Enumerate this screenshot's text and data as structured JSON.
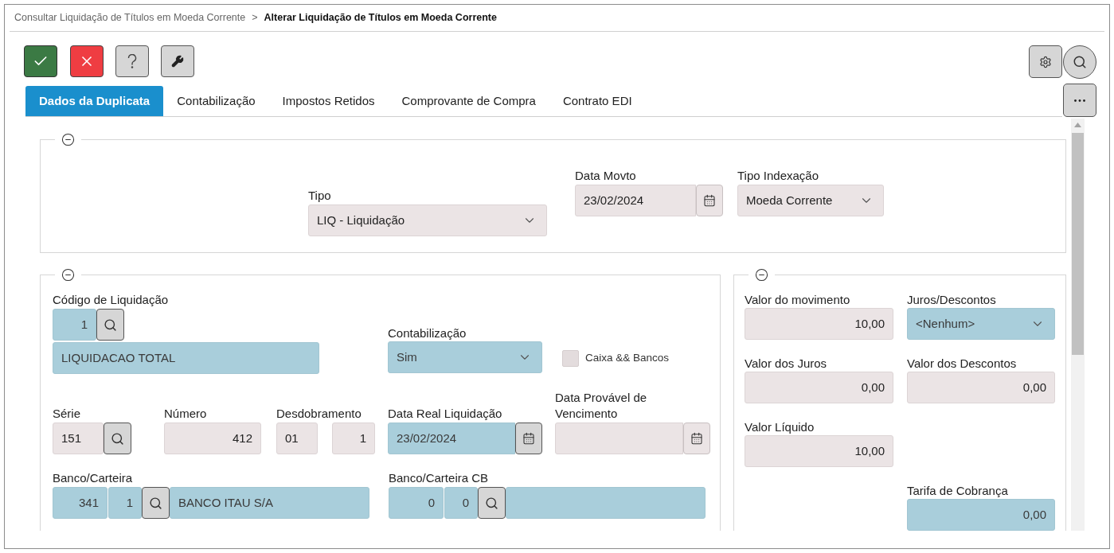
{
  "breadcrumb": [
    {
      "label": "Consultar Liquidação de Títulos em Moeda Corrente",
      "current": false
    },
    {
      "label": "Alterar Liquidação de Títulos em Moeda Corrente",
      "current": true
    }
  ],
  "breadcrumb_separator": ">",
  "tabs": [
    {
      "label": "Dados da Duplicata",
      "selected": true
    },
    {
      "label": "Contabilização",
      "selected": false
    },
    {
      "label": "Impostos Retidos",
      "selected": false
    },
    {
      "label": "Comprovante de Compra",
      "selected": false
    },
    {
      "label": "Contrato EDI",
      "selected": false
    }
  ],
  "header_section": {
    "fields": [
      {
        "label": "Tipo",
        "value": "LIQ - Liquidação",
        "kind": "select",
        "highlighted": false
      },
      {
        "label": "Data Movto",
        "value": "23/02/2024",
        "kind": "date",
        "highlighted": false
      },
      {
        "label": "Tipo Indexação",
        "value": "Moeda Corrente",
        "kind": "select",
        "highlighted": false
      }
    ]
  },
  "liquidation_section": {
    "codigo": {
      "label": "Código de Liquidação",
      "code": "1",
      "description": "LIQUIDACAO TOTAL",
      "highlighted": true
    },
    "contabilizacao": {
      "label": "Contabilização",
      "value": "Sim",
      "highlighted": true
    },
    "caixa_bancos": {
      "label": "Caixa && Bancos",
      "checked": false
    },
    "serie": {
      "label": "Série",
      "value": "151",
      "highlighted": false
    },
    "numero": {
      "label": "Número",
      "value": "412",
      "highlighted": false
    },
    "desdobramento": {
      "label": "Desdobramento",
      "values": [
        "01",
        "1"
      ],
      "highlighted": false
    },
    "data_real": {
      "label": "Data Real Liquidação",
      "value": "23/02/2024",
      "highlighted": true
    },
    "data_provavel": {
      "label": "Data Provável de Vencimento",
      "highlighted": false
    },
    "banco_carteira": {
      "label": "Banco/Carteira",
      "bank": "341",
      "wallet": "1",
      "name": "BANCO ITAU S/A",
      "highlighted": true
    },
    "banco_carteira_cb": {
      "label": "Banco/Carteira CB",
      "bank": "0",
      "wallet": "0",
      "highlighted": true
    }
  },
  "values_section": {
    "fields": [
      {
        "label": "Valor do movimento",
        "value": "10,00",
        "kind": "number",
        "highlighted": false
      },
      {
        "label": "Juros/Descontos",
        "value": "<Nenhum>",
        "kind": "select",
        "highlighted": true
      },
      {
        "label": "Valor dos Juros",
        "value": "0,00",
        "kind": "number",
        "highlighted": false
      },
      {
        "label": "Valor dos Descontos",
        "value": "0,00",
        "kind": "number",
        "highlighted": false
      },
      {
        "label": "Valor Líquido",
        "value": "10,00",
        "kind": "number",
        "highlighted": false
      },
      {
        "label": "Tarifa de Cobrança",
        "value": "0,00",
        "kind": "number",
        "highlighted": true
      }
    ]
  }
}
